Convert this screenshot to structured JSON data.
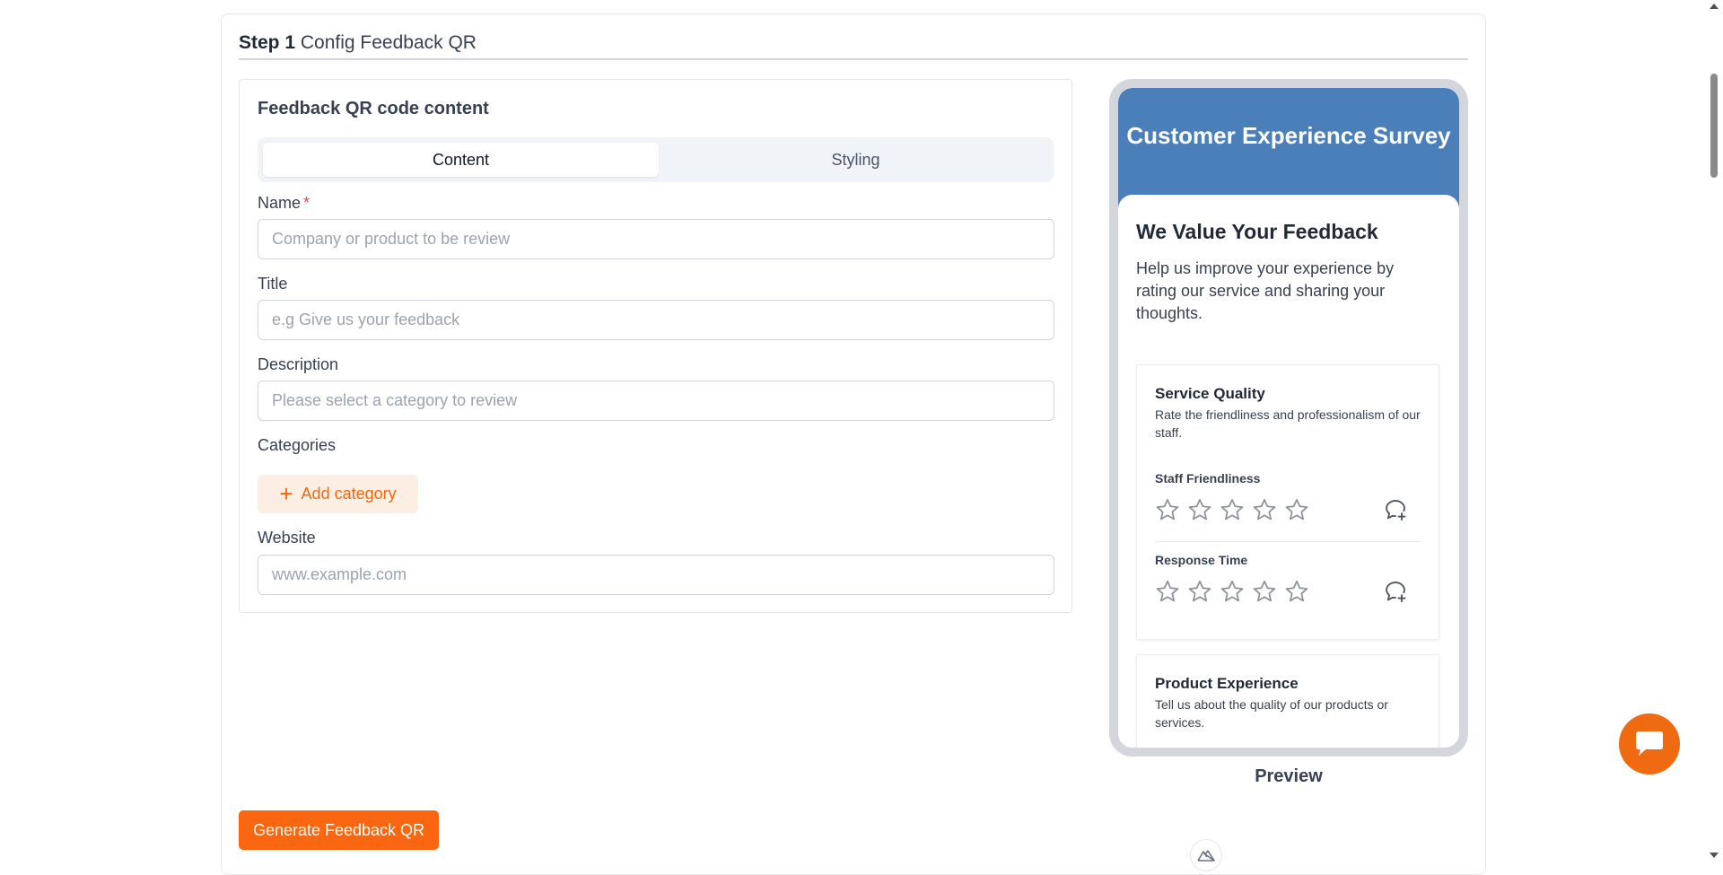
{
  "step": {
    "number": "Step 1",
    "title": "Config Feedback QR"
  },
  "form": {
    "card_title": "Feedback QR code content",
    "tabs": [
      {
        "label": "Content",
        "active": true
      },
      {
        "label": "Styling",
        "active": false
      }
    ],
    "name": {
      "label": "Name",
      "required_mark": "*",
      "placeholder": "Company or product to be review",
      "value": ""
    },
    "title": {
      "label": "Title",
      "placeholder": "e.g Give us your feedback",
      "value": ""
    },
    "description": {
      "label": "Description",
      "placeholder": "Please select a category to review",
      "value": ""
    },
    "categories": {
      "label": "Categories",
      "add_button": "Add category",
      "add_icon": "plus-icon"
    },
    "website": {
      "label": "Website",
      "placeholder": "www.example.com",
      "value": ""
    }
  },
  "generate_button": "Generate Feedback QR",
  "preview": {
    "label": "Preview",
    "header_title": "Customer Experience Survey",
    "heading": "We Value Your Feedback",
    "description": "Help us improve your experience by rating our service and sharing your thoughts.",
    "sections": [
      {
        "title": "Service Quality",
        "description": "Rate the friendliness and professionalism of our staff.",
        "questions": [
          {
            "label": "Staff Friendliness",
            "rating": 0,
            "max": 5
          },
          {
            "label": "Response Time",
            "rating": 0,
            "max": 5
          }
        ]
      },
      {
        "title": "Product Experience",
        "description": "Tell us about the quality of our products or services."
      }
    ]
  },
  "colors": {
    "accent": "#fb6610",
    "preview_header": "#4a7fba",
    "add_category_bg": "#fdeee4",
    "required": "#ef4444"
  },
  "icons": {
    "star": "star-outline-icon",
    "comment": "comment-add-icon",
    "chat": "chat-bubble-icon",
    "logo": "mountain-logo-icon"
  }
}
